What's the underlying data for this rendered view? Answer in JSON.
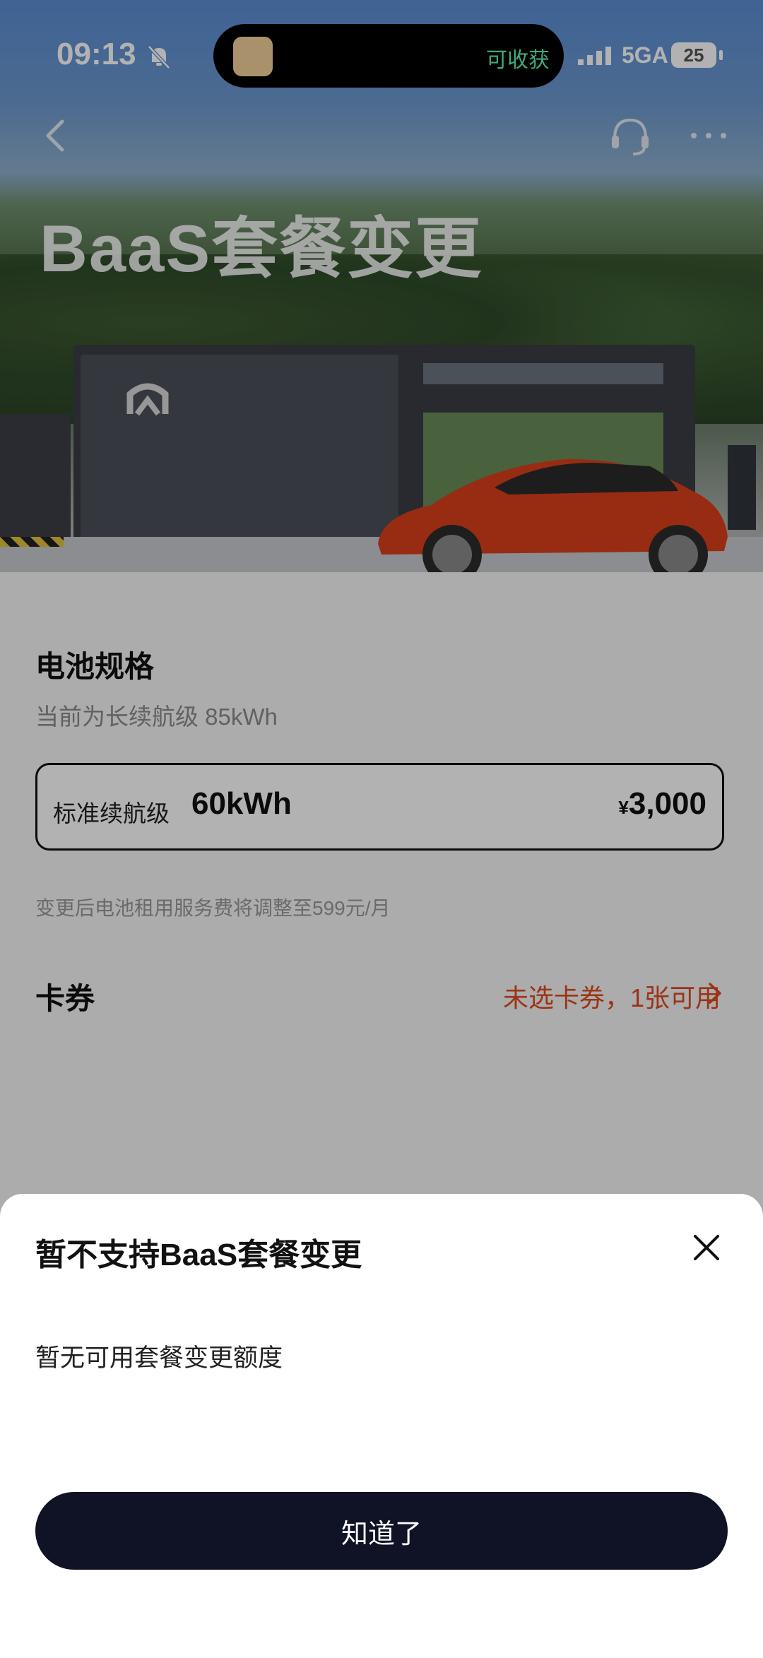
{
  "status_bar": {
    "time": "09:13",
    "island_text": "可收获",
    "network": "5GA",
    "battery": "25"
  },
  "header": {
    "title": "BaaS套餐变更"
  },
  "battery_spec": {
    "title": "电池规格",
    "current": "当前为长续航级 85kWh",
    "option": {
      "name": "标准续航级",
      "capacity": "60kWh",
      "currency": "¥",
      "price": "3,000"
    },
    "note": "变更后电池租用服务费将调整至599元/月"
  },
  "coupon": {
    "label": "卡券",
    "status": "未选卡券，1张可用"
  },
  "sheet": {
    "title": "暂不支持BaaS套餐变更",
    "message": "暂无可用套餐变更额度",
    "confirm": "知道了"
  },
  "colors": {
    "accent_red": "#e04a1f",
    "button_dark": "#0f1325",
    "island_green": "#5ef5b0"
  },
  "icons": [
    "bell-muted-icon",
    "signal-icon",
    "back-icon",
    "headset-icon",
    "more-icon",
    "chevron-right-icon",
    "close-icon"
  ]
}
